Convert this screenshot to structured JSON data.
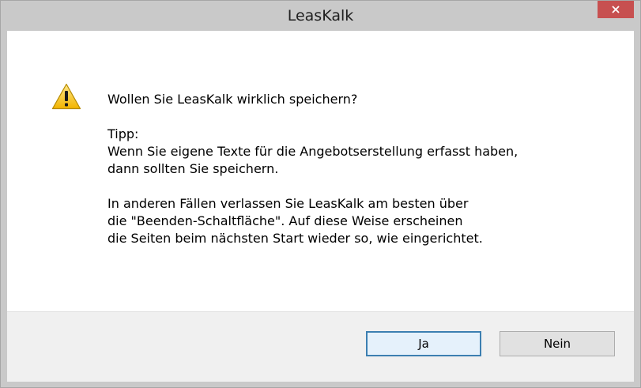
{
  "window": {
    "title": "LeasKalk"
  },
  "dialog": {
    "icon": "warning-icon",
    "question": "Wollen Sie LeasKalk wirklich speichern?",
    "tip_heading": "Tipp:",
    "tip_lines": "Wenn Sie eigene Texte für die Angebotserstellung erfasst haben,\ndann sollten Sie speichern.",
    "other_lines": "In anderen Fällen verlassen Sie LeasKalk am besten über\ndie \"Beenden-Schaltfläche\". Auf diese Weise erscheinen\ndie Seiten beim nächsten Start wieder so, wie eingerichtet."
  },
  "buttons": {
    "yes_label": "Ja",
    "no_label": "Nein"
  },
  "colors": {
    "titlebar": "#c9c9c9",
    "close_button": "#c75050",
    "footer": "#f0f0f0",
    "default_button_border": "#3c7fb1"
  }
}
